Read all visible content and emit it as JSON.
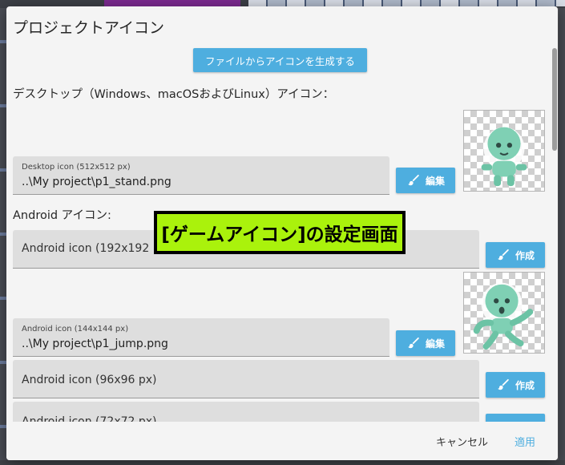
{
  "dialog": {
    "title": "プロジェクトアイコン",
    "generate_button": "ファイルからアイコンを生成する"
  },
  "desktop": {
    "section_label": "デスクトップ（Windows、macOSおよびLinux）アイコン：",
    "icon_field": {
      "caption": "Desktop icon (512x512 px)",
      "value": "..\\My project\\p1_stand.png"
    },
    "edit_button": "編集"
  },
  "android": {
    "section_label": "Android アイコン:",
    "icon_192": {
      "placeholder": "Android icon (192x192 px)",
      "button": "作成"
    },
    "icon_144": {
      "caption": "Android icon (144x144 px)",
      "value": "..\\My project\\p1_jump.png",
      "button": "編集"
    },
    "icon_96": {
      "placeholder": "Android icon (96x96 px)",
      "button": "作成"
    },
    "icon_72": {
      "placeholder": "Android icon (72x72 px)"
    }
  },
  "footer": {
    "cancel": "キャンセル",
    "apply": "適用"
  },
  "overlay": {
    "caption": "[ゲームアイコン]の設定画面"
  },
  "icons": {
    "edit": "brush-icon",
    "create": "brush-icon"
  },
  "colors": {
    "accent": "#4eaedf",
    "overlay_bg": "#aaf20c",
    "dialog_bg": "#f4f4f4",
    "field_bg": "#dedede"
  }
}
